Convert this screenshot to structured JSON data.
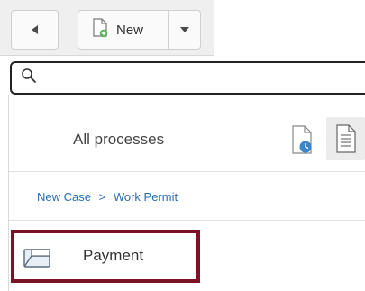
{
  "toolbar": {
    "new_label": "New"
  },
  "search": {
    "value": "",
    "placeholder": ""
  },
  "processes": {
    "title": "All processes"
  },
  "breadcrumb": {
    "items": [
      "New Case",
      "Work Permit"
    ],
    "separator": ">"
  },
  "list": {
    "items": [
      {
        "label": "Payment",
        "icon": "form-window-icon",
        "highlighted": true
      }
    ]
  },
  "colors": {
    "highlight_border": "#7a1325",
    "link": "#2a6db3"
  }
}
